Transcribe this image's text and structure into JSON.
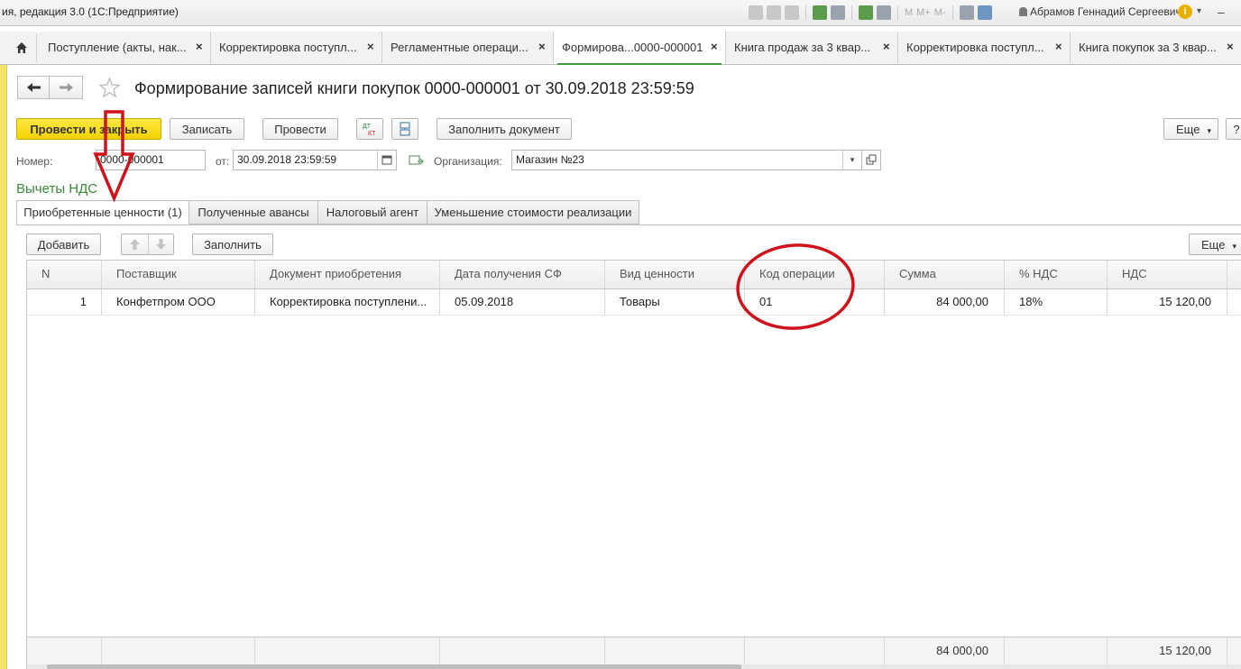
{
  "window": {
    "title": "ия, редакция 3.0  (1С:Предприятие)",
    "toolbar_text": [
      "M",
      "M+",
      "M-"
    ],
    "user": "Абрамов Геннадий Сергеевич"
  },
  "tabs": [
    {
      "label": "Поступление (акты, нак..."
    },
    {
      "label": "Корректировка поступл..."
    },
    {
      "label": "Регламентные операци..."
    },
    {
      "label": "Формирова...0000-000001"
    },
    {
      "label": "Книга продаж за 3 квар..."
    },
    {
      "label": "Корректировка поступл..."
    },
    {
      "label": "Книга покупок за 3 квар..."
    }
  ],
  "document": {
    "title": "Формирование записей книги покупок 0000-000001 от 30.09.2018 23:59:59"
  },
  "commandbar": {
    "post_close": "Провести и закрыть",
    "save": "Записать",
    "post": "Провести",
    "dtkt": "ДТ КТ",
    "fill_document": "Заполнить документ",
    "more": "Еще"
  },
  "header": {
    "number_label": "Номер:",
    "number_value": "0000-000001",
    "date_label": "от:",
    "date_value": "30.09.2018 23:59:59",
    "org_label": "Организация:",
    "org_value": "Магазин №23"
  },
  "section_title": "Вычеты НДС",
  "panel_tabs": [
    {
      "label": "Приобретенные ценности (1)"
    },
    {
      "label": "Полученные авансы"
    },
    {
      "label": "Налоговый агент"
    },
    {
      "label": "Уменьшение стоимости реализации"
    }
  ],
  "table_toolbar": {
    "add": "Добавить",
    "fill": "Заполнить",
    "more": "Еще"
  },
  "table": {
    "columns": [
      "N",
      "Поставщик",
      "Документ приобретения",
      "Дата получения СФ",
      "Вид ценности",
      "Код операции",
      "Сумма",
      "% НДС",
      "НДС"
    ],
    "rows": [
      [
        "1",
        "Конфетпром ООО",
        "Корректировка поступлени...",
        "05.09.2018",
        "Товары",
        "01",
        "84 000,00",
        "18%",
        "15 120,00"
      ]
    ],
    "totals": {
      "sum": "84 000,00",
      "nds": "15 120,00"
    }
  },
  "colors": {
    "primary_button": "#f2d100",
    "section_title": "#3a8a3a",
    "annotation": "#d0121b"
  }
}
